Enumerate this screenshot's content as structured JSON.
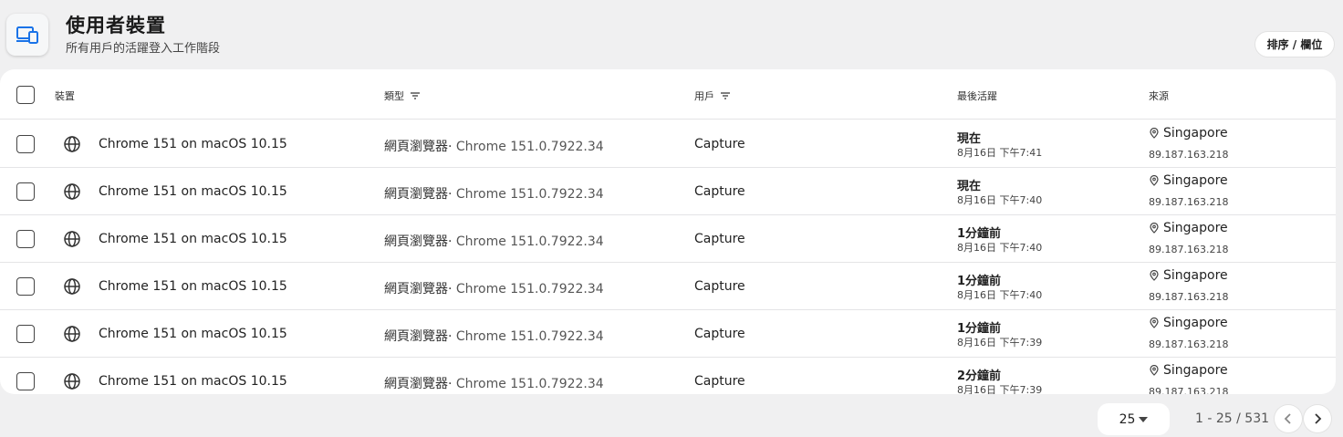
{
  "header": {
    "icon": "devices-icon",
    "title": "使用者裝置",
    "subtitle": "所有用戶的活躍登入工作階段",
    "sort_button": "排序 / 欄位"
  },
  "table": {
    "columns": {
      "device": "裝置",
      "type": "類型",
      "user": "用戶",
      "last_active": "最後活躍",
      "source": "來源"
    },
    "rows": [
      {
        "device": "Chrome 151 on macOS 10.15",
        "type_prefix": "網頁瀏覽器·",
        "type_detail": " Chrome 151.0.7922.34",
        "user": "Capture",
        "last_active": "現在",
        "last_active_time": "8月16日 下午7:41",
        "location": "Singapore",
        "ip": "89.187.163.218"
      },
      {
        "device": "Chrome 151 on macOS 10.15",
        "type_prefix": "網頁瀏覽器·",
        "type_detail": " Chrome 151.0.7922.34",
        "user": "Capture",
        "last_active": "現在",
        "last_active_time": "8月16日 下午7:40",
        "location": "Singapore",
        "ip": "89.187.163.218"
      },
      {
        "device": "Chrome 151 on macOS 10.15",
        "type_prefix": "網頁瀏覽器·",
        "type_detail": " Chrome 151.0.7922.34",
        "user": "Capture",
        "last_active": "1分鐘前",
        "last_active_time": "8月16日 下午7:40",
        "location": "Singapore",
        "ip": "89.187.163.218"
      },
      {
        "device": "Chrome 151 on macOS 10.15",
        "type_prefix": "網頁瀏覽器·",
        "type_detail": " Chrome 151.0.7922.34",
        "user": "Capture",
        "last_active": "1分鐘前",
        "last_active_time": "8月16日 下午7:40",
        "location": "Singapore",
        "ip": "89.187.163.218"
      },
      {
        "device": "Chrome 151 on macOS 10.15",
        "type_prefix": "網頁瀏覽器·",
        "type_detail": " Chrome 151.0.7922.34",
        "user": "Capture",
        "last_active": "1分鐘前",
        "last_active_time": "8月16日 下午7:39",
        "location": "Singapore",
        "ip": "89.187.163.218"
      },
      {
        "device": "Chrome 151 on macOS 10.15",
        "type_prefix": "網頁瀏覽器·",
        "type_detail": " Chrome 151.0.7922.34",
        "user": "Capture",
        "last_active": "2分鐘前",
        "last_active_time": "8月16日 下午7:39",
        "location": "Singapore",
        "ip": "89.187.163.218"
      }
    ]
  },
  "pagination": {
    "page_size": "25",
    "range": "1 - 25 / 531",
    "prev_icon": "chevron-left-icon",
    "next_icon": "chevron-right-icon"
  },
  "colors": {
    "accent": "#1a73e8",
    "background": "#f0f0f1"
  }
}
